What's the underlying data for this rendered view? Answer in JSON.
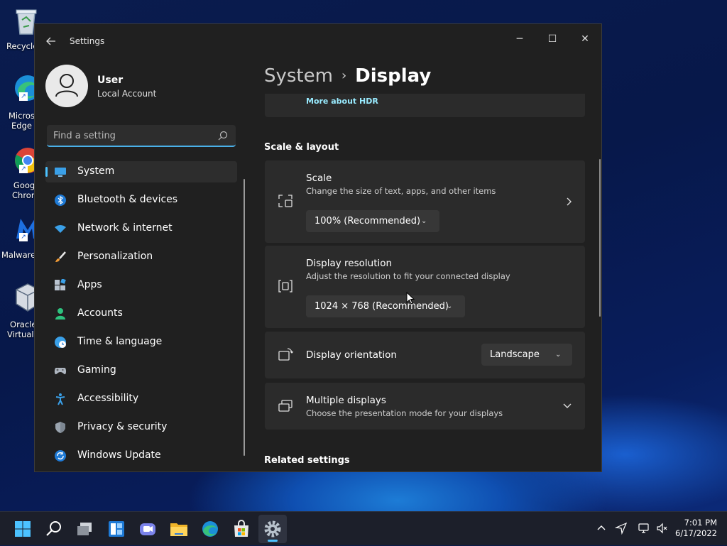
{
  "desktop": {
    "icons": [
      {
        "label": "Recycle",
        "icon": "recycle-bin-icon"
      },
      {
        "label": "Micros\nEdge",
        "icon": "edge-icon"
      },
      {
        "label": "Goog\nChron",
        "icon": "chrome-icon"
      },
      {
        "label": "Malware",
        "icon": "malwarebytes-icon"
      },
      {
        "label": "Oracle\nVirtualB",
        "icon": "virtualbox-icon"
      }
    ]
  },
  "window": {
    "app_title": "Settings",
    "back_icon": "arrow-left-icon",
    "controls": {
      "minimize": "─",
      "maximize": "☐",
      "close": "✕"
    }
  },
  "profile": {
    "name": "User",
    "account_type": "Local Account"
  },
  "search": {
    "placeholder": "Find a setting",
    "value": ""
  },
  "sidebar": {
    "items": [
      {
        "label": "System",
        "icon": "monitor-icon",
        "active": true
      },
      {
        "label": "Bluetooth & devices",
        "icon": "bluetooth-icon"
      },
      {
        "label": "Network & internet",
        "icon": "wifi-icon"
      },
      {
        "label": "Personalization",
        "icon": "brush-icon"
      },
      {
        "label": "Apps",
        "icon": "apps-icon"
      },
      {
        "label": "Accounts",
        "icon": "person-icon"
      },
      {
        "label": "Time & language",
        "icon": "globe-clock-icon"
      },
      {
        "label": "Gaming",
        "icon": "gamepad-icon"
      },
      {
        "label": "Accessibility",
        "icon": "accessibility-icon"
      },
      {
        "label": "Privacy & security",
        "icon": "shield-icon"
      },
      {
        "label": "Windows Update",
        "icon": "sync-icon"
      }
    ]
  },
  "breadcrumb": {
    "parent": "System",
    "separator": "›",
    "current": "Display"
  },
  "hdr_card": {
    "link": "More about HDR"
  },
  "scale_layout": {
    "title": "Scale & layout",
    "scale": {
      "title": "Scale",
      "subtitle": "Change the size of text, apps, and other items",
      "value": "100% (Recommended)"
    },
    "resolution": {
      "title": "Display resolution",
      "subtitle": "Adjust the resolution to fit your connected display",
      "value": "1024 × 768 (Recommended)"
    },
    "orientation": {
      "title": "Display orientation",
      "value": "Landscape"
    },
    "multiple": {
      "title": "Multiple displays",
      "subtitle": "Choose the presentation mode for your displays"
    }
  },
  "related": {
    "title": "Related settings"
  },
  "taskbar": {
    "time": "7:01 PM",
    "date": "6/17/2022"
  }
}
